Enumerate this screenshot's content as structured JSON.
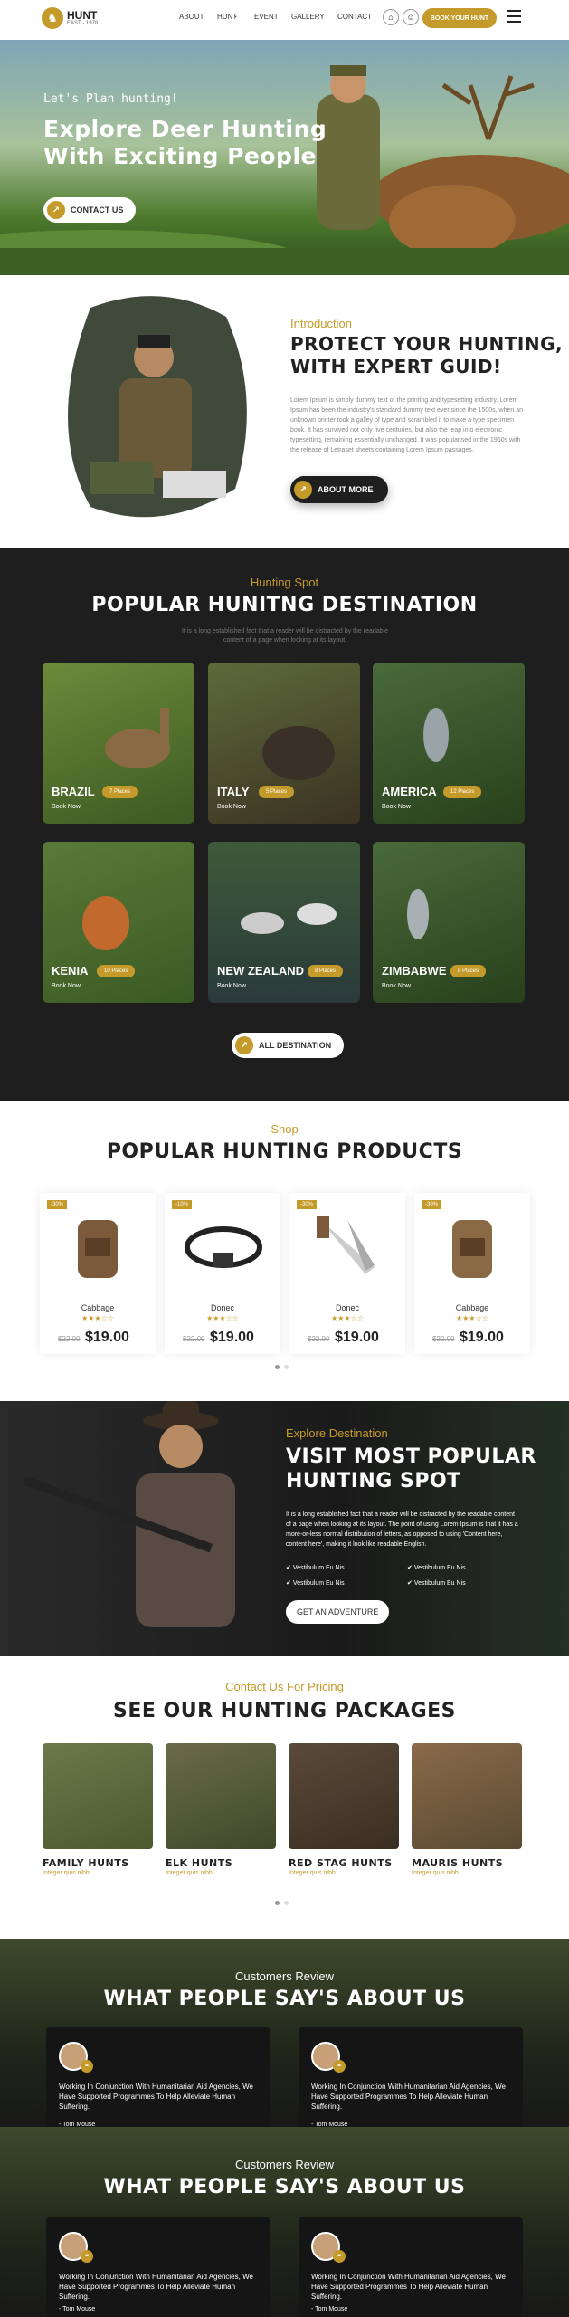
{
  "header": {
    "logo_title": "HUNT",
    "logo_sub": "EAST - 1978",
    "nav": [
      "ABOUT",
      "HUNT",
      "EVENT",
      "GALLERY",
      "CONTACT"
    ],
    "book_label": "BOOK YOUR HUNT"
  },
  "hero": {
    "subtitle": "Let's Plan hunting!",
    "title_line1": "Explore Deer Hunting",
    "title_line2": "With Exciting People",
    "button": "CONTACT US"
  },
  "intro": {
    "subtitle": "Introduction",
    "title_line1": "PROTECT YOUR HUNTING,",
    "title_line2": "WITH EXPERT GUID!",
    "text": "Lorem Ipsum is simply dummy text of the printing and typesetting industry. Lorem Ipsum has been the industry's standard dummy text ever since the 1500s, when an unknown printer took a galley of type and scrambled it to make a type specimen book. It has survived not only five centuries, but also the leap into electronic typesetting, remaining essentially unchanged. It was popularised in the 1960s with the release of Letraset sheets containing Lorem Ipsum passages.",
    "button": "ABOUT MORE"
  },
  "spot": {
    "subtitle": "Hunting Spot",
    "title": "POPULAR HUNITNG DESTINATION",
    "desc": "It is a long established fact that a reader will be distracted by the readable content of a page when looking at its layout.",
    "book_label": "Book Now",
    "button": "ALL DESTINATION",
    "destinations": [
      {
        "name": "BRAZIL",
        "places": "7 Places"
      },
      {
        "name": "ITALY",
        "places": "5 Places"
      },
      {
        "name": "AMERICA",
        "places": "12 Places"
      },
      {
        "name": "KENIA",
        "places": "10 Places"
      },
      {
        "name": "NEW ZEALAND",
        "places": "8 Places"
      },
      {
        "name": "ZIMBABWE",
        "places": "8 Places"
      }
    ]
  },
  "products": {
    "subtitle": "Shop",
    "title": "POPULAR HUNTING PRODUCTS",
    "items": [
      {
        "tag": "-30%",
        "name": "Cabbage",
        "old": "$22.00",
        "price": "$19.00",
        "stars": "★★★☆☆"
      },
      {
        "tag": "-10%",
        "name": "Donec",
        "old": "$22.00",
        "price": "$19.00",
        "stars": "★★★☆☆"
      },
      {
        "tag": "-30%",
        "name": "Donec",
        "old": "$22.00",
        "price": "$19.00",
        "stars": "★★★☆☆"
      },
      {
        "tag": "-30%",
        "name": "Cabbage",
        "old": "$22.00",
        "price": "$19.00",
        "stars": "★★★☆☆"
      }
    ]
  },
  "explore": {
    "subtitle": "Explore Destination",
    "title_line1": "VISIT MOST POPULAR",
    "title_line2": "HUNTING SPOT",
    "text": "It is a long established fact that a reader will be distracted by the readable content of a page when looking at its layout. The point of using Lorem Ipsum is that it has a more-or-less normal distribution of letters, as opposed to using 'Content here, content here', making it look like readable English.",
    "checks": [
      "Vestibulum Eu Nis",
      "Vestibulum Eu Nis",
      "Vestibulum Eu Nis",
      "Vestibulum Eu Nis"
    ],
    "button": "GET AN ADVENTURE"
  },
  "packages": {
    "subtitle": "Contact Us For Pricing",
    "title": "SEE OUR HUNTING PACKAGES",
    "items": [
      {
        "name": "FAMILY HUNTS",
        "sub": "Integer quis nibh"
      },
      {
        "name": "ELK HUNTS",
        "sub": "Integer quis nibh"
      },
      {
        "name": "RED STAG HUNTS",
        "sub": "Integer quis nibh"
      },
      {
        "name": "MAURIS HUNTS",
        "sub": "Integer quis nibh"
      }
    ]
  },
  "reviews": {
    "subtitle": "Customers Review",
    "title": "WHAT PEOPLE SAY'S ABOUT US",
    "text": "Working In Conjunction With Humanitarian Aid Agencies, We Have Supported Programmes To Help Alleviate Human Suffering.",
    "author": "- Tom Mouse"
  },
  "colors": {
    "accent": "#c49a2a",
    "dark": "#1e1e1e"
  }
}
